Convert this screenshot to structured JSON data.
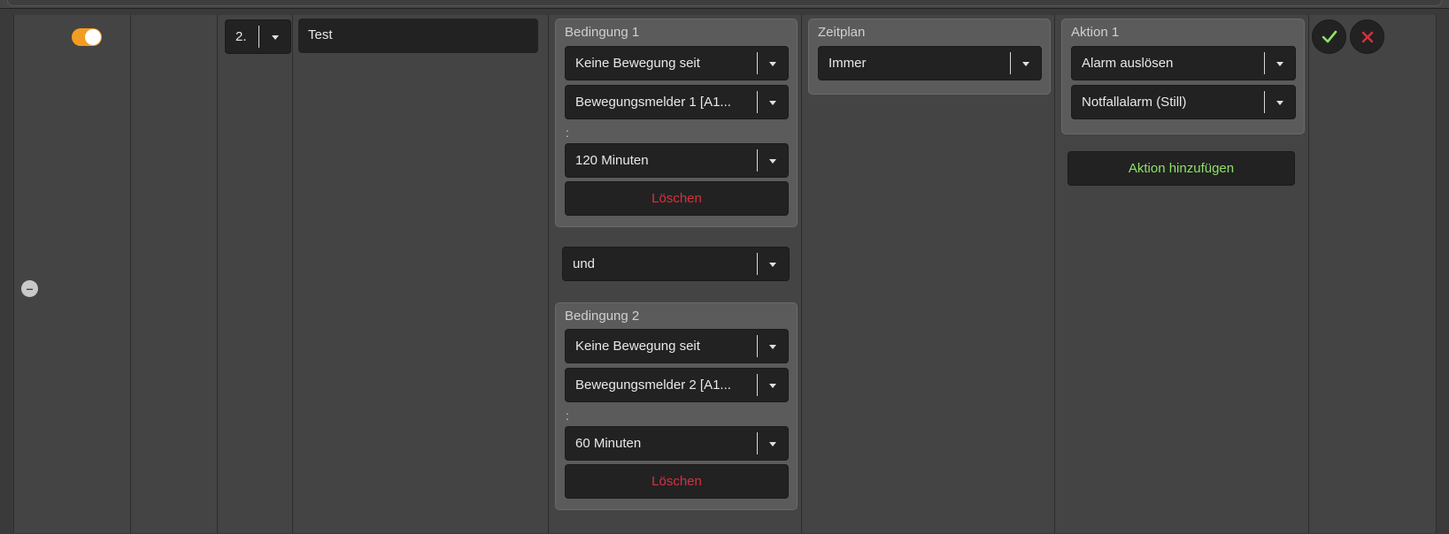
{
  "row": {
    "enabled": true,
    "priority": "2.",
    "name": "Test",
    "conditions": [
      {
        "title": "Bedingung 1",
        "type": "Keine Bewegung seit",
        "sensor": "Bewegungsmelder 1 [A1...",
        "separator": ":",
        "duration": "120 Minuten",
        "delete_label": "Löschen"
      },
      {
        "title": "Bedingung 2",
        "type": "Keine Bewegung seit",
        "sensor": "Bewegungsmelder 2 [A1...",
        "separator": ":",
        "duration": "60 Minuten",
        "delete_label": "Löschen"
      }
    ],
    "logic": "und",
    "schedule": {
      "title": "Zeitplan",
      "value": "Immer"
    },
    "actions": [
      {
        "title": "Aktion 1",
        "type": "Alarm auslösen",
        "value": "Notfallalarm (Still)"
      }
    ],
    "add_action_label": "Aktion hinzufügen"
  },
  "colors": {
    "toggle_on": "#f39c22",
    "delete_text": "#d9303f",
    "add_text": "#8fe06a",
    "confirm": "#8fe06a",
    "cancel": "#d9303f"
  },
  "icons": {
    "confirm": "checkmark-icon",
    "cancel": "close-icon",
    "collapse": "minus-icon",
    "dropdown": "caret-down-icon"
  }
}
